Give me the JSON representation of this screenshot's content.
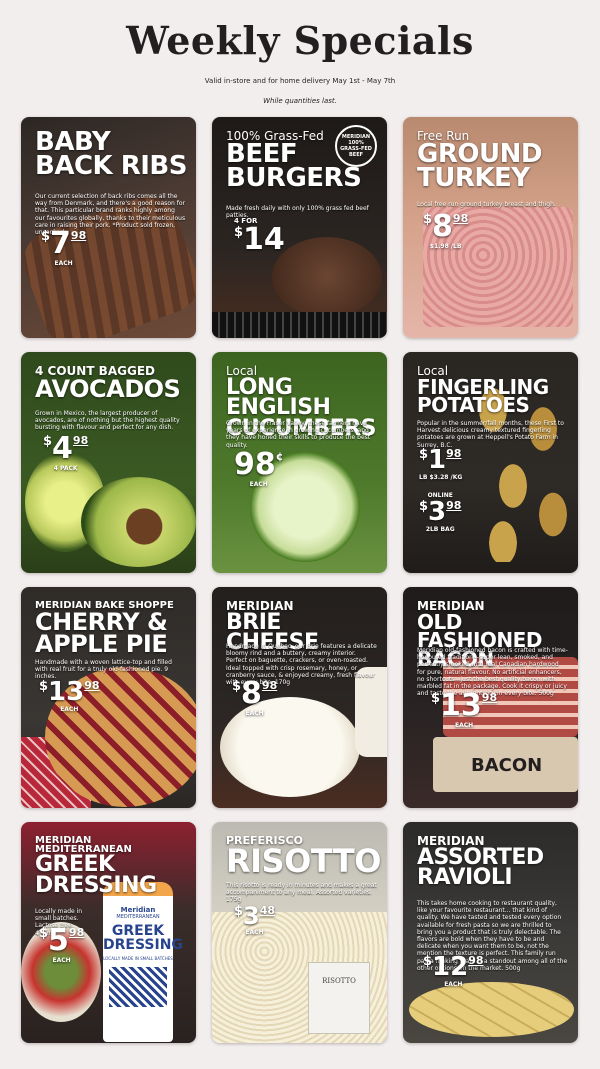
{
  "header": {
    "title": "Weekly Specials",
    "valid_text": "Valid in-store and for home delivery May 1st - May 7th",
    "while_text": "While quantities last."
  },
  "cards": [
    {
      "pre": "",
      "title": "BABY BACK RIBS",
      "desc": "Our current selection of back ribs comes all the way from Denmark, and there's a good reason for that. This particular brand ranks highly among our favourites globally, thanks to their meticulous care in raising their pork. *Product sold frozen, uncooked",
      "price": {
        "cur": "$",
        "amt": "7",
        "cents": "98",
        "unit": "EACH"
      },
      "colors": {
        "bg": "#4a3a33",
        "accent": "#7b4a2e"
      }
    },
    {
      "pre": "100% Grass-Fed",
      "title": "BEEF BURGERS",
      "desc": "Made fresh daily with only 100% grass fed beef patties.",
      "badge": "MERIDIAN 100% GRASS-FED BEEF",
      "price": {
        "cur": "$",
        "amt": "14",
        "cents": "",
        "unit": "",
        "prefix": "4 FOR"
      },
      "colors": {
        "bg": "#2b2522",
        "accent": "#6b4532"
      }
    },
    {
      "pre": "Free Run",
      "title": "GROUND TURKEY",
      "desc": "Local free run ground turkey breast and thigh.",
      "price": {
        "cur": "$",
        "amt": "8",
        "cents": "98",
        "unit": "$1.98 /LB"
      },
      "colors": {
        "bg": "#c9977e",
        "accent": "#e4a9a0"
      }
    },
    {
      "pre": "4 COUNT BAGGED",
      "title": "AVOCADOS",
      "desc": "Grown in Mexico, the largest producer of avocados, are of nothing but the highest quality bursting with flavour and perfect for any dish.",
      "price": {
        "cur": "$",
        "amt": "4",
        "cents": "98",
        "unit": "4 PACK"
      },
      "colors": {
        "bg": "#3b5a23",
        "accent": "#b7c85a"
      }
    },
    {
      "pre": "Local",
      "title": "LONG ENGLISH CUCUMBERS",
      "desc": "Grown in the Fraser Valley, these farmers have years of experience in growing cucumbers, and they have honed their skills to produce the best quality.",
      "price": {
        "cur": "",
        "amt": "98",
        "cents": "¢",
        "unit": "EACH"
      },
      "colors": {
        "bg": "#4f7a2c",
        "accent": "#c7dd9a"
      }
    },
    {
      "pre": "Local",
      "title": "FINGERLING POTATOES",
      "desc": "Popular in the summer/fall months, these First to Harvest delicious creamy textured fingerling potatoes are grown at Heppell's Potato Farm in Surrey, B.C.",
      "price": {
        "cur": "$",
        "amt": "1",
        "cents": "98",
        "unit": "LB $3.28 /KG"
      },
      "price2": {
        "cur": "$",
        "amt": "3",
        "cents": "98",
        "unit": "2LB BAG",
        "prefix": "ONLINE"
      },
      "colors": {
        "bg": "#2e2a26",
        "accent": "#c9a24c"
      }
    },
    {
      "pre": "MERIDIAN BAKE SHOPPE",
      "title": "CHERRY & APPLE PIE",
      "desc": "Handmade with a woven lattice-top and filled with real fruit for a truly old-fashioned pie. 9 inches.",
      "price": {
        "cur": "$",
        "amt": "13",
        "cents": "98",
        "unit": "EACH"
      },
      "colors": {
        "bg": "#3a3633",
        "accent": "#c98b46"
      }
    },
    {
      "pre": "MERIDIAN",
      "title": "BRIE CHEESE",
      "desc": "Handmade in Quebec, our Brie features a delicate bloomy rind and a buttery, creamy interior. Perfect on baguette, crackers, or oven-roasted. Ideal topped with crisp rosemary, honey, or cranberry sauce, & enjoyed creamy, fresh flavour with every bite. 170g",
      "price": {
        "cur": "$",
        "amt": "8",
        "cents": "98",
        "unit": "EACH"
      },
      "colors": {
        "bg": "#2c2725",
        "accent": "#f2ede2"
      }
    },
    {
      "pre": "MERIDIAN",
      "title": "OLD FASHIONED BACON",
      "desc": "Meridian old-fashioned bacon is crafted with time-honoured tradition—super lean, smoked, and perfectly smoked with real Canadian hardwood for pure, natural flavour. No artificial enhancers, no shortcuts—just the best quality bacon with marbled fat in the package. Cook it crispy or juicy and taste the authenticity in every bite. 500g",
      "price": {
        "cur": "$",
        "amt": "13",
        "cents": "98",
        "unit": "EACH"
      },
      "label": "BACON",
      "colors": {
        "bg": "#2a2424",
        "accent": "#b24a44"
      }
    },
    {
      "pre": "MERIDIAN MEDITERRANEAN",
      "title": "GREEK DRESSING",
      "desc": "Locally made in small batches. Lactose free. 475mL",
      "price": {
        "cur": "$",
        "amt": "5",
        "cents": "98",
        "unit": "EACH"
      },
      "bottle": {
        "brand": "Meridian",
        "line": "MEDITERRANEAN",
        "name": "GREEK DRESSING",
        "sub": "LOCALLY MADE IN SMALL BATCHES"
      },
      "colors": {
        "bg": "#3a2d2a",
        "accent": "#b8283a"
      }
    },
    {
      "pre": "PREFERISCO",
      "title": "RISOTTO",
      "desc": "This risotto is ready in minutes and makes a great accompaniment to any meal. Assorted varieties. 175g",
      "price": {
        "cur": "$",
        "amt": "3",
        "cents": "48",
        "unit": "EACH"
      },
      "pack": "RISOTTO",
      "colors": {
        "bg": "#d8d4c6",
        "accent": "#efe7cf"
      }
    },
    {
      "pre": "MERIDIAN",
      "title": "ASSORTED RAVIOLI",
      "desc": "This takes home cooking to restaurant quality, like your favourite restaurant... that kind of quality. We have tasted and tested every option available for fresh pasta so we are thrilled to bring you a product that is truly delectable. The flavors are bold when they have to be and delicate when you want them to be, not the mention the texture is perfect. This family run pasta making team is a standout among all of the other options on the market. 500g",
      "price": {
        "cur": "$",
        "amt": "12",
        "cents": "98",
        "unit": "EACH"
      },
      "colors": {
        "bg": "#3b3a38",
        "accent": "#e6cd7c"
      }
    }
  ]
}
